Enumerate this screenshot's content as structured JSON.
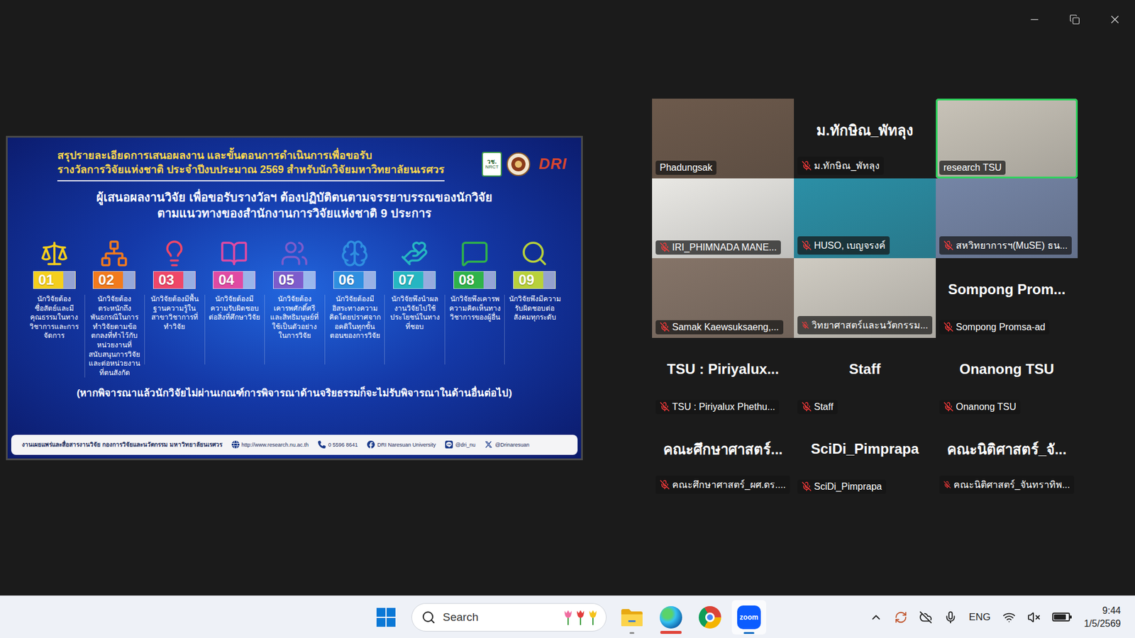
{
  "shared_screen": {
    "title_lines": [
      "สรุปรายละเอียดการเสนอผลงาน และขั้นตอนการดำเนินการเพื่อขอรับ",
      "รางวัลการวิจัยแห่งชาติ ประจำปีงบประมาณ 2569 สำหรับนักวิจัยมหาวิทยาลัยนเรศวร"
    ],
    "logos": {
      "nrct_thai": "วช.",
      "nrct_en": "NRCT",
      "dri": "DRI"
    },
    "subtitle_lines": [
      "ผู้เสนอผลงานวิจัย เพื่อขอรับรางวัลฯ ต้องปฏิบัติตนตามจรรยาบรรณของนักวิจัย",
      "ตามแนวทางของสำนักงานการวิจัยแห่งชาติ 9 ประการ"
    ],
    "items": [
      {
        "number": "01",
        "text": "นักวิจัยต้องซื่อสัตย์และมีคุณธรรมในทางวิชาการและการจัดการ",
        "color": "#f5cf1c"
      },
      {
        "number": "02",
        "text": "นักวิจัยต้องตระหนักถึงพันธกรณีในการทำวิจัยตามข้อตกลงที่ทำไว้กับหน่วยงานที่สนับสนุนการวิจัยและต่อหน่วยงานที่ตนสังกัด",
        "color": "#f27a1c"
      },
      {
        "number": "03",
        "text": "นักวิจัยต้องมีพื้นฐานความรู้ในสาขาวิชาการที่ทำวิจัย",
        "color": "#ef4768"
      },
      {
        "number": "04",
        "text": "นักวิจัยต้องมีความรับผิดชอบต่อสิ่งที่ศึกษาวิจัย",
        "color": "#e04aa3"
      },
      {
        "number": "05",
        "text": "นักวิจัยต้องเคารพศักดิ์ศรีและสิทธิมนุษย์ที่ใช้เป็นตัวอย่างในการวิจัย",
        "color": "#7d5ccc"
      },
      {
        "number": "06",
        "text": "นักวิจัยต้องมีอิสระทางความคิดโดยปราศจากอคติในทุกขั้นตอนของการวิจัย",
        "color": "#2f8fe0"
      },
      {
        "number": "07",
        "text": "นักวิจัยพึงนำผลงานวิจัยไปใช้ประโยชน์ในทางที่ชอบ",
        "color": "#26b6c2"
      },
      {
        "number": "08",
        "text": "นักวิจัยพึงเคารพความคิดเห็นทางวิชาการของผู้อื่น",
        "color": "#2fb34a"
      },
      {
        "number": "09",
        "text": "นักวิจัยพึงมีความรับผิดชอบต่อสังคมทุกระดับ",
        "color": "#b8d13a"
      }
    ],
    "note": "(หากพิจารณาแล้วนักวิจัยไม่ผ่านเกณฑ์การพิจารณาด้านจริยธรรมก็จะไม่รับพิจารณาในด้านอื่นต่อไป)",
    "footer": {
      "org": "งานเผยแพร่และสื่อสารงานวิจัย กองการวิจัยและนวัตกรรม มหาวิทยาลัยนเรศวร",
      "links": [
        {
          "kind": "web",
          "text": "http://www.research.nu.ac.th"
        },
        {
          "kind": "phone",
          "text": "0 5596 8641"
        },
        {
          "kind": "facebook",
          "text": "DRI Naresuan University"
        },
        {
          "kind": "line",
          "text": "@dri_nu"
        },
        {
          "kind": "x",
          "text": "@Drinaresuan"
        }
      ]
    }
  },
  "participants": [
    {
      "kind": "video",
      "label": "Phadungsak",
      "muted": false,
      "speaking": false,
      "color": "#6d5a4c"
    },
    {
      "kind": "avatar",
      "name": "ม.ทักษิณ_พัทลุง",
      "label": "ม.ทักษิณ_พัทลุง",
      "muted": true,
      "speaking": false
    },
    {
      "kind": "video",
      "label": "research TSU",
      "muted": false,
      "speaking": true,
      "color": "#c8c3b8"
    },
    {
      "kind": "video",
      "label": "IRI_PHIMNADA MANE...",
      "muted": true,
      "speaking": false,
      "color": "#e9e8e4"
    },
    {
      "kind": "video",
      "label": "HUSO, เบญจรงค์",
      "muted": true,
      "speaking": false,
      "color": "#2b8fa6"
    },
    {
      "kind": "video",
      "label": "สหวิทยาการฯ(MuSE) ธน...",
      "muted": true,
      "speaking": false,
      "color": "#7585a6"
    },
    {
      "kind": "video",
      "label": "Samak Kaewsuksaeng,...",
      "muted": true,
      "speaking": false,
      "color": "#857468"
    },
    {
      "kind": "video",
      "label": "วิทยาศาสตร์และนวัตกรรม...",
      "muted": true,
      "speaking": false,
      "color": "#cfcbc2"
    },
    {
      "kind": "avatar",
      "name": "Sompong Prom...",
      "label": "Sompong Promsa-ad",
      "muted": true,
      "speaking": false
    },
    {
      "kind": "avatar",
      "name": "TSU : Piriyalux...",
      "label": "TSU : Piriyalux Phethu...",
      "muted": true,
      "speaking": false
    },
    {
      "kind": "avatar",
      "name": "Staff",
      "label": "Staff",
      "muted": true,
      "speaking": false
    },
    {
      "kind": "avatar",
      "name": "Onanong TSU",
      "label": "Onanong TSU",
      "muted": true,
      "speaking": false
    },
    {
      "kind": "avatar",
      "name": "คณะศึกษาศาสตร์...",
      "label": "คณะศึกษาศาสตร์_ผศ.ดร....",
      "muted": true,
      "speaking": false
    },
    {
      "kind": "avatar",
      "name": "SciDi_Pimprapa",
      "label": "SciDi_Pimprapa",
      "muted": true,
      "speaking": false
    },
    {
      "kind": "avatar",
      "name": "คณะนิติศาสตร์_จั...",
      "label": "คณะนิติศาสตร์_จันทราทิพ...",
      "muted": true,
      "speaking": false
    }
  ],
  "taskbar": {
    "search_placeholder": "Search",
    "apps": [
      {
        "kind": "explorer",
        "state": "running"
      },
      {
        "kind": "edge",
        "state": "flashing"
      },
      {
        "kind": "chrome",
        "state": "none"
      },
      {
        "kind": "zoom",
        "state": "active",
        "label": "zoom"
      }
    ],
    "tray": {
      "language": "ENG",
      "sound_muted": true,
      "battery_level": 0.85,
      "time": "9:44",
      "date": "1/5/2569"
    }
  }
}
